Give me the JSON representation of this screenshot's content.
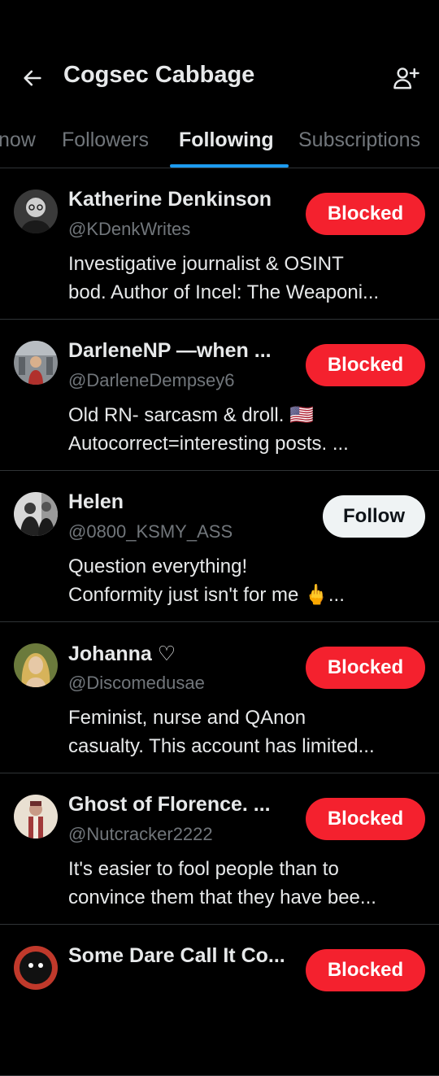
{
  "header": {
    "title": "Cogsec Cabbage",
    "back_icon": "arrow-left-icon",
    "add_icon": "person-plus-icon"
  },
  "tabs": [
    "now",
    "Followers",
    "Following",
    "Subscriptions"
  ],
  "active_tab": "Following",
  "colors": {
    "accent": "#1d9bf0",
    "blocked": "#f4212e",
    "muted": "#71767b",
    "divider": "#2f3336"
  },
  "users": [
    {
      "name": "Katherine Denkinson",
      "handle": "@KDenkWrites",
      "bio1": "Investigative journalist & OSINT",
      "bio2": "bod. Author of Incel: The Weaponi...",
      "button": "Blocked"
    },
    {
      "name": "DarleneNP —when ...",
      "handle": "@DarleneDempsey6",
      "bio1": "Old RN-  sarcasm & droll. 🇺🇸",
      "bio2": "Autocorrect=interesting posts. ...",
      "button": "Blocked"
    },
    {
      "name": "Helen",
      "handle": "@0800_KSMY_ASS",
      "bio1": "Question everything!",
      "bio2": "Conformity just isn't for me 🖕...",
      "button": "Follow"
    },
    {
      "name": "Johanna ♡",
      "handle": "@Discomedusae",
      "bio1": "Feminist, nurse and QAnon",
      "bio2": "casualty. This account has limited...",
      "button": "Blocked"
    },
    {
      "name": "Ghost of Florence. ...",
      "handle": "@Nutcracker2222",
      "bio1": "It's easier to fool people than to",
      "bio2": "convince them that they have bee...",
      "button": "Blocked"
    },
    {
      "name": "Some Dare Call It Co...",
      "handle": "",
      "bio1": "",
      "bio2": "",
      "button": "Blocked"
    }
  ]
}
